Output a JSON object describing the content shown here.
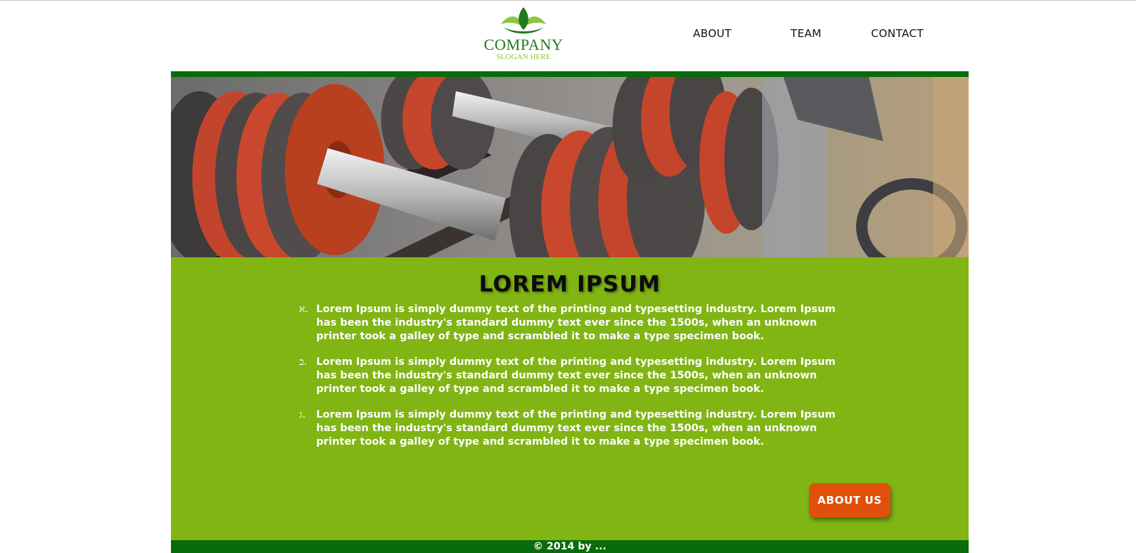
{
  "header": {
    "logo": {
      "name": "COMPANY",
      "slogan": "SLOGAN HERE",
      "icon": "leaf-logo-icon"
    },
    "nav": [
      {
        "label": "ABOUT"
      },
      {
        "label": "TEAM"
      },
      {
        "label": "CONTACT"
      }
    ]
  },
  "hero": {
    "image": "dumbbell-rack-photo"
  },
  "content": {
    "title": "LOREM IPSUM",
    "items": [
      {
        "marker": "א.",
        "text": "Lorem Ipsum is simply dummy text of the printing and typesetting industry. Lorem Ipsum has been the industry's standard dummy text ever since the 1500s, when an unknown printer took a galley of type and scrambled it to make a type specimen book."
      },
      {
        "marker": "ב.",
        "text": "Lorem Ipsum is simply dummy text of the printing and typesetting industry. Lorem Ipsum has been the industry's standard dummy text ever since the 1500s, when an unknown printer took a galley of type and scrambled it to make a type specimen book."
      },
      {
        "marker": "ג.",
        "text": "Lorem Ipsum is simply dummy text of the printing and typesetting industry. Lorem Ipsum has been the industry's standard dummy text ever since the 1500s, when an unknown printer took a galley of type and scrambled it to make a type specimen book."
      }
    ],
    "button_label": "ABOUT US"
  },
  "footer": {
    "text": "© 2014 by ..."
  },
  "colors": {
    "dark_green": "#0a6b0a",
    "lime_green": "#80b514",
    "orange": "#e0500a",
    "logo_green": "#1f7a1f",
    "slogan_green": "#8cc63f"
  }
}
